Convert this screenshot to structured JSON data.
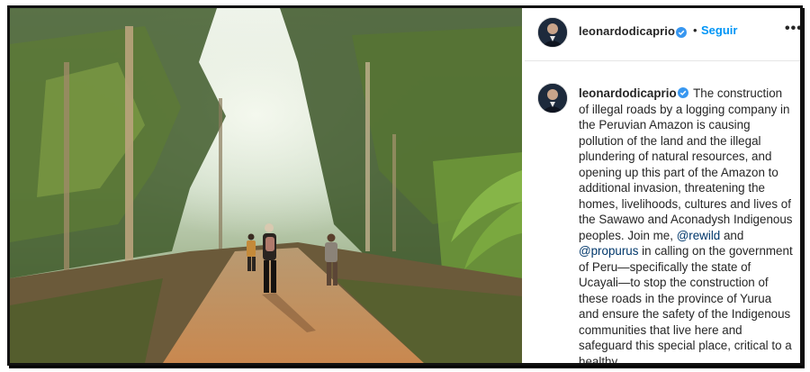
{
  "post": {
    "username": "leonardodicaprio",
    "follow_label": "Seguir",
    "separator": "•",
    "more_label": "•••",
    "caption": {
      "username": "leonardodicaprio",
      "part1": " The construction of illegal roads by a logging company in the Peruvian Amazon is causing pollution of the land and the illegal plundering of natural resources, and opening up this part of the Amazon to additional invasion, threatening the homes, livelihoods, cultures and lives of the Sawawo and Aconadysh Indigenous peoples. Join me, ",
      "mention1": "@rewild",
      "part2": " and ",
      "mention2": "@propurus",
      "part3": " in calling on the government of Peru—specifically the state of Ucayali—to stop the construction of these roads in the province of Yurua and ensure the safety of the Indigenous communities that live here and safeguard this special place, critical to a healthy"
    }
  },
  "colors": {
    "accent": "#0095f6",
    "mention": "#00376b",
    "verified": "#3897f0",
    "text": "#262626"
  },
  "icons": {
    "verified": "verified-badge-icon",
    "more": "more-options-icon"
  }
}
